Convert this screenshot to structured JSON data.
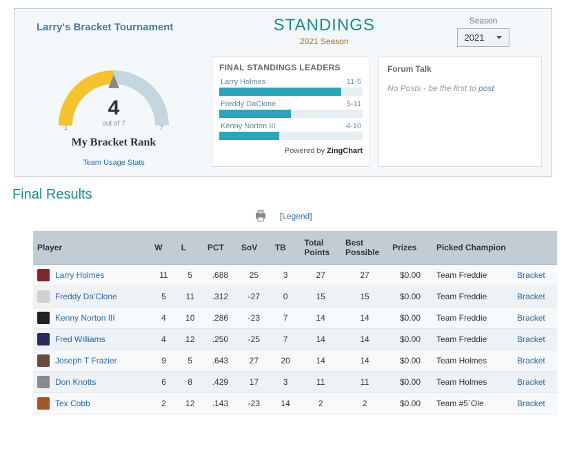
{
  "header": {
    "tournament_name": "Larry's Bracket Tournament",
    "standings_title": "STANDINGS",
    "season_line": "2021 Season",
    "season_label": "Season",
    "season_value": "2021"
  },
  "rank": {
    "value": "4",
    "out_of": "out of 7",
    "min": "1",
    "max": "7",
    "label": "My Bracket Rank",
    "team_usage": "Team Usage Stats"
  },
  "leaders": {
    "title": "FINAL STANDINGS LEADERS",
    "items": [
      {
        "name": "Larry Holmes",
        "record": "11-5",
        "pct": 85
      },
      {
        "name": "Freddy DaClone",
        "record": "5-11",
        "pct": 50
      },
      {
        "name": "Kenny Norton III",
        "record": "4-10",
        "pct": 42
      }
    ],
    "powered_by_prefix": "Powered by ",
    "powered_by_brand": "ZingChart"
  },
  "forum": {
    "title": "Forum Talk",
    "empty_prefix": "No Posts - be the first to ",
    "post_link": "post"
  },
  "final_results_heading": "Final Results",
  "toolbar": {
    "legend": "[Legend]"
  },
  "table": {
    "headers": {
      "player": "Player",
      "w": "W",
      "l": "L",
      "pct": "PCT",
      "sov": "SoV",
      "tb": "TB",
      "total": "Total Points",
      "best": "Best Possible",
      "prizes": "Prizes",
      "champion": "Picked Champion"
    },
    "bracket_label": "Bracket",
    "rows": [
      {
        "avatar_color": "#7a2a2a",
        "player": "Larry Holmes",
        "w": "11",
        "l": "5",
        "pct": ".688",
        "sov": "25",
        "tb": "3",
        "total": "27",
        "best": "27",
        "prize": "$0.00",
        "champion": "Team Freddie"
      },
      {
        "avatar_color": "#d0d0d0",
        "player": "Freddy Da'Clone",
        "w": "5",
        "l": "11",
        "pct": ".312",
        "sov": "-27",
        "tb": "0",
        "total": "15",
        "best": "15",
        "prize": "$0.00",
        "champion": "Team Freddie"
      },
      {
        "avatar_color": "#222222",
        "player": "Kenny Norton III",
        "w": "4",
        "l": "10",
        "pct": ".286",
        "sov": "-23",
        "tb": "7",
        "total": "14",
        "best": "14",
        "prize": "$0.00",
        "champion": "Team Freddie"
      },
      {
        "avatar_color": "#2a2a5a",
        "player": "Fred Williams",
        "w": "4",
        "l": "12",
        "pct": ".250",
        "sov": "-25",
        "tb": "7",
        "total": "14",
        "best": "14",
        "prize": "$0.00",
        "champion": "Team Freddie"
      },
      {
        "avatar_color": "#6a4a3a",
        "player": "Joseph T Frazier",
        "w": "9",
        "l": "5",
        "pct": ".643",
        "sov": "27",
        "tb": "20",
        "total": "14",
        "best": "14",
        "prize": "$0.00",
        "champion": "Team Holmes"
      },
      {
        "avatar_color": "#8a8a8a",
        "player": "Don Knotts",
        "w": "6",
        "l": "8",
        "pct": ".429",
        "sov": "17",
        "tb": "3",
        "total": "11",
        "best": "11",
        "prize": "$0.00",
        "champion": "Team Holmes"
      },
      {
        "avatar_color": "#a05a2a",
        "player": "Tex Cobb",
        "w": "2",
        "l": "12",
        "pct": ".143",
        "sov": "-23",
        "tb": "14",
        "total": "2",
        "best": "2",
        "prize": "$0.00",
        "champion": "Team #5`Ole"
      }
    ]
  },
  "chart_data": {
    "type": "bar",
    "title": "FINAL STANDINGS LEADERS",
    "categories": [
      "Larry Holmes",
      "Freddy DaClone",
      "Kenny Norton III"
    ],
    "values_label": [
      "11-5",
      "5-11",
      "4-10"
    ],
    "values": [
      11,
      5,
      4
    ],
    "xlim": [
      0,
      16
    ]
  }
}
